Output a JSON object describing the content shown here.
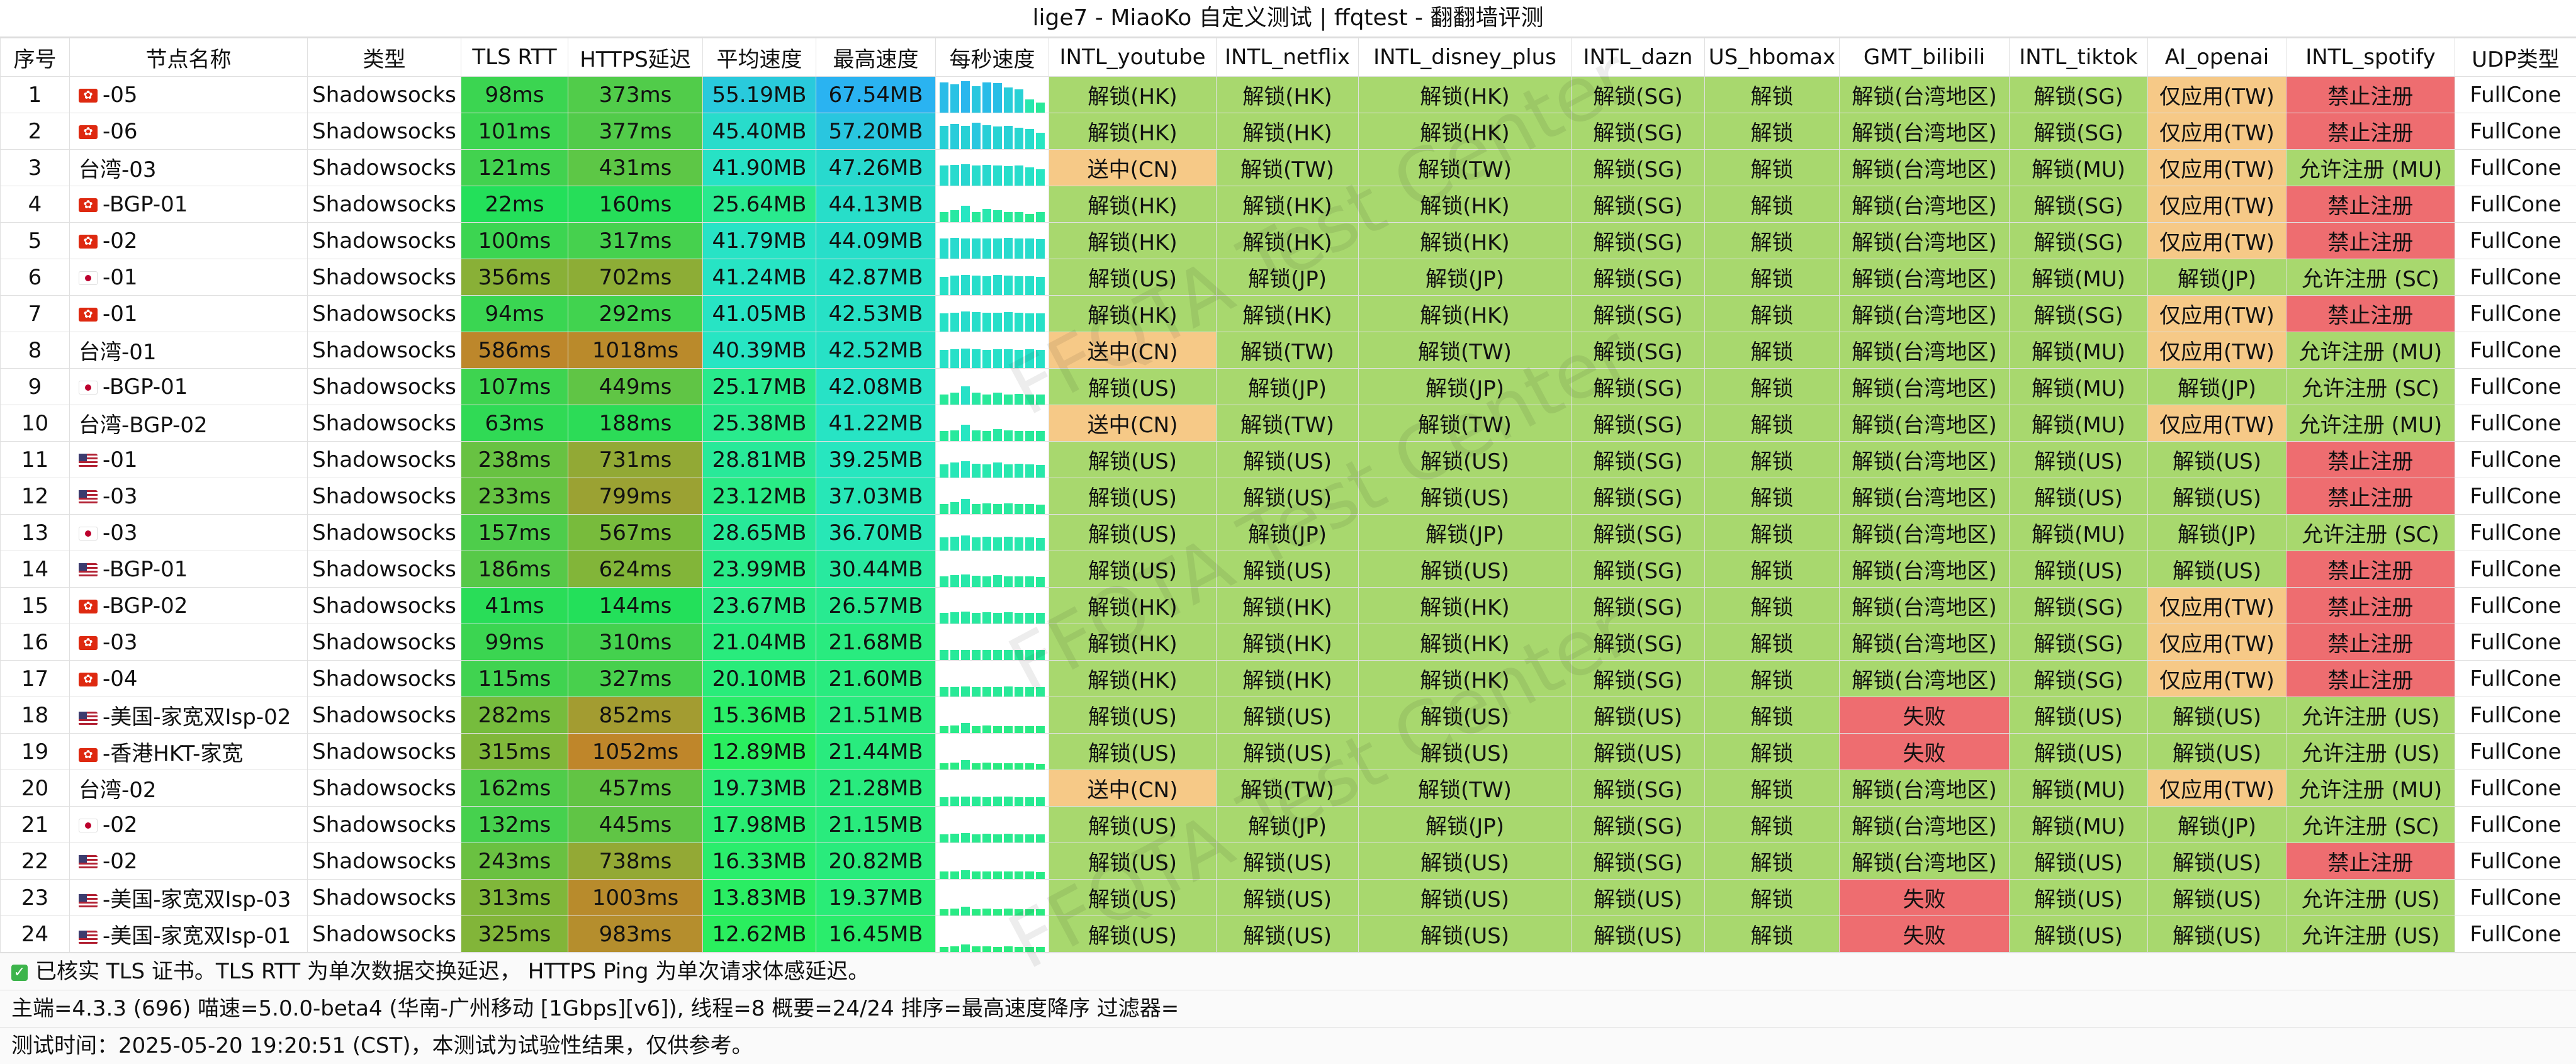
{
  "title": "lige7 - MiaoKo 自定义测试 | ffqtest - 翻翻墙评测",
  "columns": [
    "序号",
    "节点名称",
    "类型",
    "TLS RTT",
    "HTTPS延迟",
    "平均速度",
    "最高速度",
    "每秒速度",
    "INTL_youtube",
    "INTL_netflix",
    "INTL_disney_plus",
    "INTL_dazn",
    "US_hbomax",
    "GMT_bilibili",
    "INTL_tiktok",
    "AI_openai",
    "INTL_spotify",
    "UDP类型"
  ],
  "watermark": "FFQTA Test Center",
  "colors": {
    "unlock": "#a8d86e",
    "partial": "#f6c987",
    "fail": "#ee6d70",
    "spotify_ok": "#a8d86e"
  },
  "rows": [
    {
      "id": "1",
      "flag": "hk",
      "name": "-05",
      "type": "Shadowsocks",
      "tls": "98ms",
      "https": "373ms",
      "avg": "55.19MB",
      "max": "67.54MB",
      "spark": [
        0.9,
        0.85,
        0.95,
        0.8,
        0.9,
        0.88,
        0.75,
        0.7,
        0.4,
        0.3
      ],
      "yt": "解锁(HK)",
      "nf": "解锁(HK)",
      "dp": "解锁(HK)",
      "dazn": "解锁(SG)",
      "hbo": "解锁",
      "bili": "解锁(台湾地区)",
      "tt": "解锁(SG)",
      "ai": "仅应用(TW)",
      "sp": "禁止注册",
      "udp": "FullCone"
    },
    {
      "id": "2",
      "flag": "hk",
      "name": "-06",
      "type": "Shadowsocks",
      "tls": "101ms",
      "https": "377ms",
      "avg": "45.40MB",
      "max": "57.20MB",
      "spark": [
        0.7,
        0.75,
        0.7,
        0.8,
        0.72,
        0.68,
        0.7,
        0.65,
        0.6,
        0.5
      ],
      "yt": "解锁(HK)",
      "nf": "解锁(HK)",
      "dp": "解锁(HK)",
      "dazn": "解锁(SG)",
      "hbo": "解锁",
      "bili": "解锁(台湾地区)",
      "tt": "解锁(SG)",
      "ai": "仅应用(TW)",
      "sp": "禁止注册",
      "udp": "FullCone"
    },
    {
      "id": "3",
      "flag": "",
      "name": "台湾-03",
      "type": "Shadowsocks",
      "tls": "121ms",
      "https": "431ms",
      "avg": "41.90MB",
      "max": "47.26MB",
      "spark": [
        0.6,
        0.62,
        0.65,
        0.6,
        0.63,
        0.6,
        0.58,
        0.6,
        0.55,
        0.5
      ],
      "yt": "送中(CN)",
      "nf": "解锁(TW)",
      "dp": "解锁(TW)",
      "dazn": "解锁(SG)",
      "hbo": "解锁",
      "bili": "解锁(台湾地区)",
      "tt": "解锁(MU)",
      "ai": "仅应用(TW)",
      "sp": "允许注册 (MU)",
      "udp": "FullCone"
    },
    {
      "id": "4",
      "flag": "hk",
      "name": "-BGP-01",
      "type": "Shadowsocks",
      "tls": "22ms",
      "https": "160ms",
      "avg": "25.64MB",
      "max": "44.13MB",
      "spark": [
        0.3,
        0.35,
        0.5,
        0.3,
        0.4,
        0.35,
        0.3,
        0.3,
        0.25,
        0.3
      ],
      "yt": "解锁(HK)",
      "nf": "解锁(HK)",
      "dp": "解锁(HK)",
      "dazn": "解锁(SG)",
      "hbo": "解锁",
      "bili": "解锁(台湾地区)",
      "tt": "解锁(SG)",
      "ai": "仅应用(TW)",
      "sp": "禁止注册",
      "udp": "FullCone"
    },
    {
      "id": "5",
      "flag": "hk",
      "name": "-02",
      "type": "Shadowsocks",
      "tls": "100ms",
      "https": "317ms",
      "avg": "41.79MB",
      "max": "44.09MB",
      "spark": [
        0.6,
        0.62,
        0.6,
        0.61,
        0.6,
        0.6,
        0.62,
        0.6,
        0.6,
        0.58
      ],
      "yt": "解锁(HK)",
      "nf": "解锁(HK)",
      "dp": "解锁(HK)",
      "dazn": "解锁(SG)",
      "hbo": "解锁",
      "bili": "解锁(台湾地区)",
      "tt": "解锁(SG)",
      "ai": "仅应用(TW)",
      "sp": "禁止注册",
      "udp": "FullCone"
    },
    {
      "id": "6",
      "flag": "jp",
      "name": "-01",
      "type": "Shadowsocks",
      "tls": "356ms",
      "https": "702ms",
      "avg": "41.24MB",
      "max": "42.87MB",
      "spark": [
        0.55,
        0.58,
        0.6,
        0.58,
        0.57,
        0.6,
        0.58,
        0.56,
        0.57,
        0.55
      ],
      "yt": "解锁(US)",
      "nf": "解锁(JP)",
      "dp": "解锁(JP)",
      "dazn": "解锁(SG)",
      "hbo": "解锁",
      "bili": "解锁(台湾地区)",
      "tt": "解锁(MU)",
      "ai": "解锁(JP)",
      "sp": "允许注册 (SC)",
      "udp": "FullCone"
    },
    {
      "id": "7",
      "flag": "hk",
      "name": "-01",
      "type": "Shadowsocks",
      "tls": "94ms",
      "https": "292ms",
      "avg": "41.05MB",
      "max": "42.53MB",
      "spark": [
        0.55,
        0.57,
        0.6,
        0.58,
        0.56,
        0.57,
        0.58,
        0.56,
        0.55,
        0.55
      ],
      "yt": "解锁(HK)",
      "nf": "解锁(HK)",
      "dp": "解锁(HK)",
      "dazn": "解锁(SG)",
      "hbo": "解锁",
      "bili": "解锁(台湾地区)",
      "tt": "解锁(SG)",
      "ai": "仅应用(TW)",
      "sp": "禁止注册",
      "udp": "FullCone"
    },
    {
      "id": "8",
      "flag": "",
      "name": "台湾-01",
      "type": "Shadowsocks",
      "tls": "586ms",
      "https": "1018ms",
      "avg": "40.39MB",
      "max": "42.52MB",
      "spark": [
        0.55,
        0.56,
        0.58,
        0.57,
        0.55,
        0.56,
        0.57,
        0.55,
        0.56,
        0.55
      ],
      "yt": "送中(CN)",
      "nf": "解锁(TW)",
      "dp": "解锁(TW)",
      "dazn": "解锁(SG)",
      "hbo": "解锁",
      "bili": "解锁(台湾地区)",
      "tt": "解锁(MU)",
      "ai": "仅应用(TW)",
      "sp": "允许注册 (MU)",
      "udp": "FullCone"
    },
    {
      "id": "9",
      "flag": "jp",
      "name": "-BGP-01",
      "type": "Shadowsocks",
      "tls": "107ms",
      "https": "449ms",
      "avg": "25.17MB",
      "max": "42.08MB",
      "spark": [
        0.3,
        0.35,
        0.55,
        0.35,
        0.3,
        0.35,
        0.3,
        0.32,
        0.3,
        0.3
      ],
      "yt": "解锁(US)",
      "nf": "解锁(JP)",
      "dp": "解锁(JP)",
      "dazn": "解锁(SG)",
      "hbo": "解锁",
      "bili": "解锁(台湾地区)",
      "tt": "解锁(MU)",
      "ai": "解锁(JP)",
      "sp": "允许注册 (SC)",
      "udp": "FullCone"
    },
    {
      "id": "10",
      "flag": "",
      "name": "台湾-BGP-02",
      "type": "Shadowsocks",
      "tls": "63ms",
      "https": "188ms",
      "avg": "25.38MB",
      "max": "41.22MB",
      "spark": [
        0.3,
        0.32,
        0.5,
        0.33,
        0.3,
        0.35,
        0.32,
        0.3,
        0.3,
        0.3
      ],
      "yt": "送中(CN)",
      "nf": "解锁(TW)",
      "dp": "解锁(TW)",
      "dazn": "解锁(SG)",
      "hbo": "解锁",
      "bili": "解锁(台湾地区)",
      "tt": "解锁(MU)",
      "ai": "仅应用(TW)",
      "sp": "允许注册 (MU)",
      "udp": "FullCone"
    },
    {
      "id": "11",
      "flag": "us",
      "name": "-01",
      "type": "Shadowsocks",
      "tls": "238ms",
      "https": "731ms",
      "avg": "28.81MB",
      "max": "39.25MB",
      "spark": [
        0.4,
        0.45,
        0.5,
        0.42,
        0.4,
        0.45,
        0.4,
        0.42,
        0.4,
        0.38
      ],
      "yt": "解锁(US)",
      "nf": "解锁(US)",
      "dp": "解锁(US)",
      "dazn": "解锁(SG)",
      "hbo": "解锁",
      "bili": "解锁(台湾地区)",
      "tt": "解锁(US)",
      "ai": "解锁(US)",
      "sp": "禁止注册",
      "udp": "FullCone"
    },
    {
      "id": "12",
      "flag": "us",
      "name": "-03",
      "type": "Shadowsocks",
      "tls": "233ms",
      "https": "799ms",
      "avg": "23.12MB",
      "max": "37.03MB",
      "spark": [
        0.3,
        0.35,
        0.45,
        0.3,
        0.32,
        0.3,
        0.33,
        0.3,
        0.3,
        0.28
      ],
      "yt": "解锁(US)",
      "nf": "解锁(US)",
      "dp": "解锁(US)",
      "dazn": "解锁(SG)",
      "hbo": "解锁",
      "bili": "解锁(台湾地区)",
      "tt": "解锁(US)",
      "ai": "解锁(US)",
      "sp": "禁止注册",
      "udp": "FullCone"
    },
    {
      "id": "13",
      "flag": "jp",
      "name": "-03",
      "type": "Shadowsocks",
      "tls": "157ms",
      "https": "567ms",
      "avg": "28.65MB",
      "max": "36.70MB",
      "spark": [
        0.4,
        0.42,
        0.45,
        0.4,
        0.42,
        0.4,
        0.41,
        0.4,
        0.4,
        0.38
      ],
      "yt": "解锁(US)",
      "nf": "解锁(JP)",
      "dp": "解锁(JP)",
      "dazn": "解锁(SG)",
      "hbo": "解锁",
      "bili": "解锁(台湾地区)",
      "tt": "解锁(MU)",
      "ai": "解锁(JP)",
      "sp": "允许注册 (SC)",
      "udp": "FullCone"
    },
    {
      "id": "14",
      "flag": "us",
      "name": "-BGP-01",
      "type": "Shadowsocks",
      "tls": "186ms",
      "https": "624ms",
      "avg": "23.99MB",
      "max": "30.44MB",
      "spark": [
        0.33,
        0.35,
        0.38,
        0.34,
        0.33,
        0.35,
        0.33,
        0.32,
        0.33,
        0.3
      ],
      "yt": "解锁(US)",
      "nf": "解锁(US)",
      "dp": "解锁(US)",
      "dazn": "解锁(SG)",
      "hbo": "解锁",
      "bili": "解锁(台湾地区)",
      "tt": "解锁(US)",
      "ai": "解锁(US)",
      "sp": "禁止注册",
      "udp": "FullCone"
    },
    {
      "id": "15",
      "flag": "hk",
      "name": "-BGP-02",
      "type": "Shadowsocks",
      "tls": "41ms",
      "https": "144ms",
      "avg": "23.67MB",
      "max": "26.57MB",
      "spark": [
        0.33,
        0.34,
        0.35,
        0.33,
        0.34,
        0.33,
        0.34,
        0.33,
        0.33,
        0.32
      ],
      "yt": "解锁(HK)",
      "nf": "解锁(HK)",
      "dp": "解锁(HK)",
      "dazn": "解锁(SG)",
      "hbo": "解锁",
      "bili": "解锁(台湾地区)",
      "tt": "解锁(SG)",
      "ai": "仅应用(TW)",
      "sp": "禁止注册",
      "udp": "FullCone"
    },
    {
      "id": "16",
      "flag": "hk",
      "name": "-03",
      "type": "Shadowsocks",
      "tls": "99ms",
      "https": "310ms",
      "avg": "21.04MB",
      "max": "21.68MB",
      "spark": [
        0.3,
        0.3,
        0.31,
        0.3,
        0.3,
        0.3,
        0.31,
        0.3,
        0.3,
        0.3
      ],
      "yt": "解锁(HK)",
      "nf": "解锁(HK)",
      "dp": "解锁(HK)",
      "dazn": "解锁(SG)",
      "hbo": "解锁",
      "bili": "解锁(台湾地区)",
      "tt": "解锁(SG)",
      "ai": "仅应用(TW)",
      "sp": "禁止注册",
      "udp": "FullCone"
    },
    {
      "id": "17",
      "flag": "hk",
      "name": "-04",
      "type": "Shadowsocks",
      "tls": "115ms",
      "https": "327ms",
      "avg": "20.10MB",
      "max": "21.60MB",
      "spark": [
        0.28,
        0.29,
        0.3,
        0.29,
        0.28,
        0.29,
        0.3,
        0.29,
        0.28,
        0.28
      ],
      "yt": "解锁(HK)",
      "nf": "解锁(HK)",
      "dp": "解锁(HK)",
      "dazn": "解锁(SG)",
      "hbo": "解锁",
      "bili": "解锁(台湾地区)",
      "tt": "解锁(SG)",
      "ai": "仅应用(TW)",
      "sp": "禁止注册",
      "udp": "FullCone"
    },
    {
      "id": "18",
      "flag": "us",
      "name": "-美国-家宽双Isp-02",
      "type": "Shadowsocks",
      "tls": "282ms",
      "https": "852ms",
      "avg": "15.36MB",
      "max": "21.51MB",
      "spark": [
        0.2,
        0.22,
        0.3,
        0.2,
        0.22,
        0.2,
        0.21,
        0.2,
        0.2,
        0.2
      ],
      "yt": "解锁(US)",
      "nf": "解锁(US)",
      "dp": "解锁(US)",
      "dazn": "解锁(US)",
      "hbo": "解锁",
      "bili": "失败",
      "tt": "解锁(US)",
      "ai": "解锁(US)",
      "sp": "允许注册 (US)",
      "udp": "FullCone"
    },
    {
      "id": "19",
      "flag": "hk",
      "name": "-香港HKT-家宽",
      "type": "Shadowsocks",
      "tls": "315ms",
      "https": "1052ms",
      "avg": "12.89MB",
      "max": "21.44MB",
      "spark": [
        0.18,
        0.2,
        0.28,
        0.18,
        0.2,
        0.18,
        0.19,
        0.18,
        0.18,
        0.17
      ],
      "yt": "解锁(US)",
      "nf": "解锁(US)",
      "dp": "解锁(US)",
      "dazn": "解锁(US)",
      "hbo": "解锁",
      "bili": "失败",
      "tt": "解锁(US)",
      "ai": "解锁(US)",
      "sp": "允许注册 (US)",
      "udp": "FullCone"
    },
    {
      "id": "20",
      "flag": "",
      "name": "台湾-02",
      "type": "Shadowsocks",
      "tls": "162ms",
      "https": "457ms",
      "avg": "19.73MB",
      "max": "21.28MB",
      "spark": [
        0.27,
        0.28,
        0.29,
        0.28,
        0.27,
        0.28,
        0.28,
        0.27,
        0.27,
        0.27
      ],
      "yt": "送中(CN)",
      "nf": "解锁(TW)",
      "dp": "解锁(TW)",
      "dazn": "解锁(SG)",
      "hbo": "解锁",
      "bili": "解锁(台湾地区)",
      "tt": "解锁(MU)",
      "ai": "仅应用(TW)",
      "sp": "允许注册 (MU)",
      "udp": "FullCone"
    },
    {
      "id": "21",
      "flag": "jp",
      "name": "-02",
      "type": "Shadowsocks",
      "tls": "132ms",
      "https": "445ms",
      "avg": "17.98MB",
      "max": "21.15MB",
      "spark": [
        0.25,
        0.26,
        0.28,
        0.25,
        0.26,
        0.25,
        0.26,
        0.25,
        0.25,
        0.24
      ],
      "yt": "解锁(US)",
      "nf": "解锁(JP)",
      "dp": "解锁(JP)",
      "dazn": "解锁(SG)",
      "hbo": "解锁",
      "bili": "解锁(台湾地区)",
      "tt": "解锁(MU)",
      "ai": "解锁(JP)",
      "sp": "允许注册 (SC)",
      "udp": "FullCone"
    },
    {
      "id": "22",
      "flag": "us",
      "name": "-02",
      "type": "Shadowsocks",
      "tls": "243ms",
      "https": "738ms",
      "avg": "16.33MB",
      "max": "20.82MB",
      "spark": [
        0.22,
        0.23,
        0.27,
        0.22,
        0.23,
        0.22,
        0.23,
        0.22,
        0.22,
        0.21
      ],
      "yt": "解锁(US)",
      "nf": "解锁(US)",
      "dp": "解锁(US)",
      "dazn": "解锁(SG)",
      "hbo": "解锁",
      "bili": "解锁(台湾地区)",
      "tt": "解锁(US)",
      "ai": "解锁(US)",
      "sp": "禁止注册",
      "udp": "FullCone"
    },
    {
      "id": "23",
      "flag": "us",
      "name": "-美国-家宽双Isp-03",
      "type": "Shadowsocks",
      "tls": "313ms",
      "https": "1003ms",
      "avg": "13.83MB",
      "max": "19.37MB",
      "spark": [
        0.18,
        0.2,
        0.26,
        0.19,
        0.2,
        0.19,
        0.2,
        0.19,
        0.18,
        0.18
      ],
      "yt": "解锁(US)",
      "nf": "解锁(US)",
      "dp": "解锁(US)",
      "dazn": "解锁(US)",
      "hbo": "解锁",
      "bili": "失败",
      "tt": "解锁(US)",
      "ai": "解锁(US)",
      "sp": "允许注册 (US)",
      "udp": "FullCone"
    },
    {
      "id": "24",
      "flag": "us",
      "name": "-美国-家宽双Isp-01",
      "type": "Shadowsocks",
      "tls": "325ms",
      "https": "983ms",
      "avg": "12.62MB",
      "max": "16.45MB",
      "spark": [
        0.16,
        0.17,
        0.22,
        0.17,
        0.17,
        0.16,
        0.17,
        0.16,
        0.16,
        0.16
      ],
      "yt": "解锁(US)",
      "nf": "解锁(US)",
      "dp": "解锁(US)",
      "dazn": "解锁(US)",
      "hbo": "解锁",
      "bili": "失败",
      "tt": "解锁(US)",
      "ai": "解锁(US)",
      "sp": "允许注册 (US)",
      "udp": "FullCone"
    }
  ],
  "footer": {
    "line1": "已核实 TLS 证书。TLS RTT 为单次数据交换延迟， HTTPS Ping 为单次请求体感延迟。",
    "line2": "主端=4.3.3 (696) 喵速=5.0.0-beta4 (华南-广州移动 [1Gbps][v6]), 线程=8 概要=24/24 排序=最高速度降序 过滤器=",
    "line3": "测试时间：2025-05-20 19:20:51 (CST)，本测试为试验性结果，仅供参考。"
  }
}
